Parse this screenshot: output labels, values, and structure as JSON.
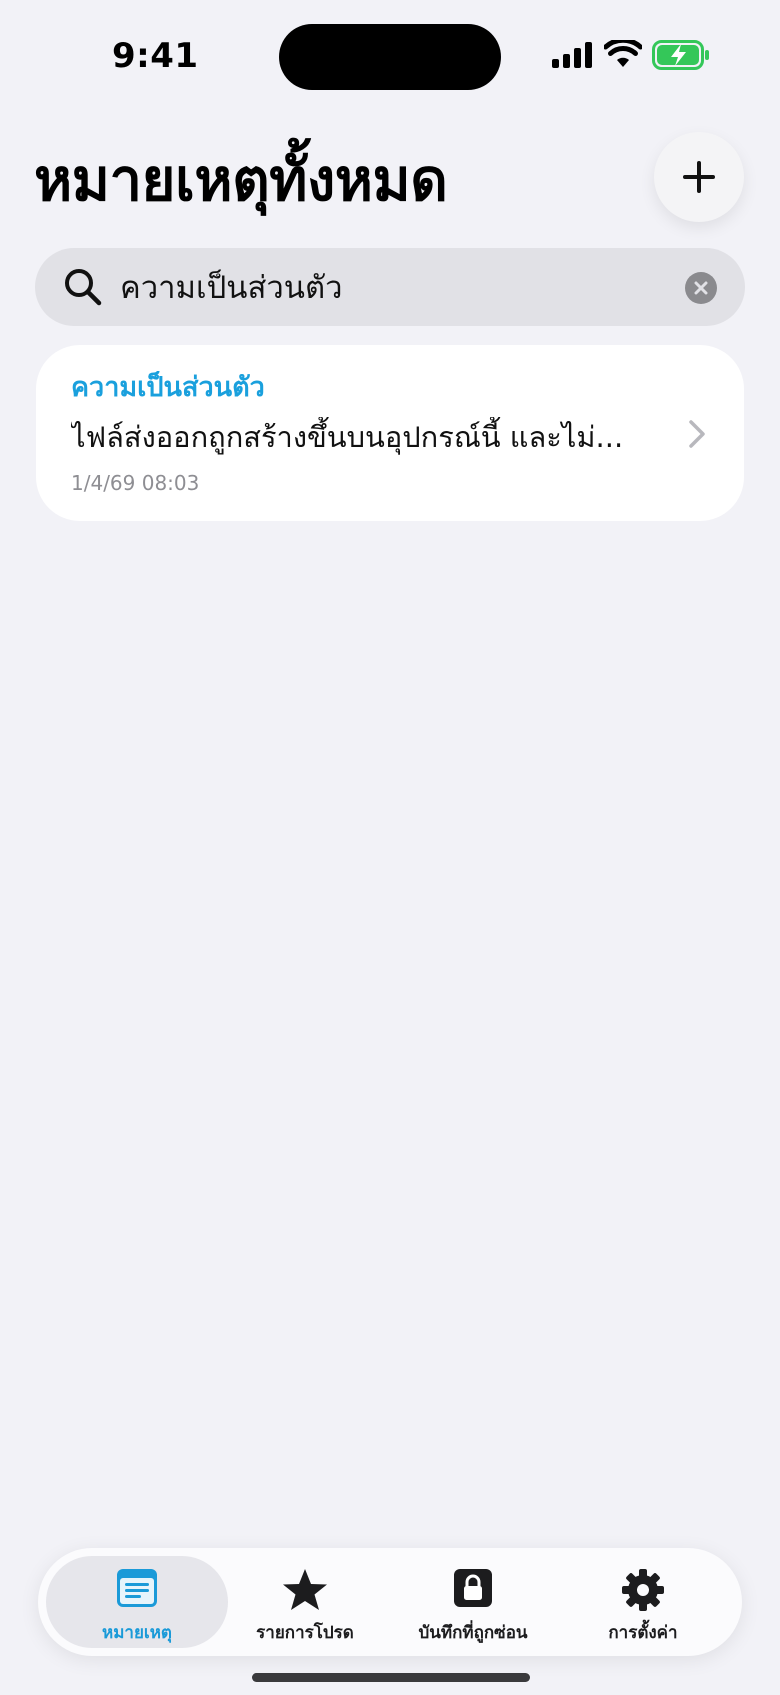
{
  "status_bar": {
    "time": "9:41",
    "icons": [
      "cellular-signal-icon",
      "wifi-icon",
      "battery-charging-icon"
    ]
  },
  "header": {
    "title": "หมายเหตุทั้งหมด",
    "add_icon": "plus-icon"
  },
  "search": {
    "value": "ความเป็นส่วนตัว",
    "icon": "search-icon",
    "clear_icon": "clear-icon"
  },
  "notes": [
    {
      "title": "ความเป็นส่วนตัว",
      "preview": "ไฟล์ส่งออกถูกสร้างขึ้นบนอุปกรณ์นี้ และไม่...",
      "date": "1/4/69 08:03"
    }
  ],
  "tabs": [
    {
      "label": "หมายเหตุ",
      "icon": "notes-icon",
      "active": true
    },
    {
      "label": "รายการโปรด",
      "icon": "star-icon",
      "active": false
    },
    {
      "label": "บันทึกที่ถูกซ่อน",
      "icon": "lock-icon",
      "active": false
    },
    {
      "label": "การตั้งค่า",
      "icon": "gear-icon",
      "active": false
    }
  ],
  "colors": {
    "accent": "#1a9ad8",
    "background": "#f2f2f7",
    "battery": "#34c759"
  }
}
